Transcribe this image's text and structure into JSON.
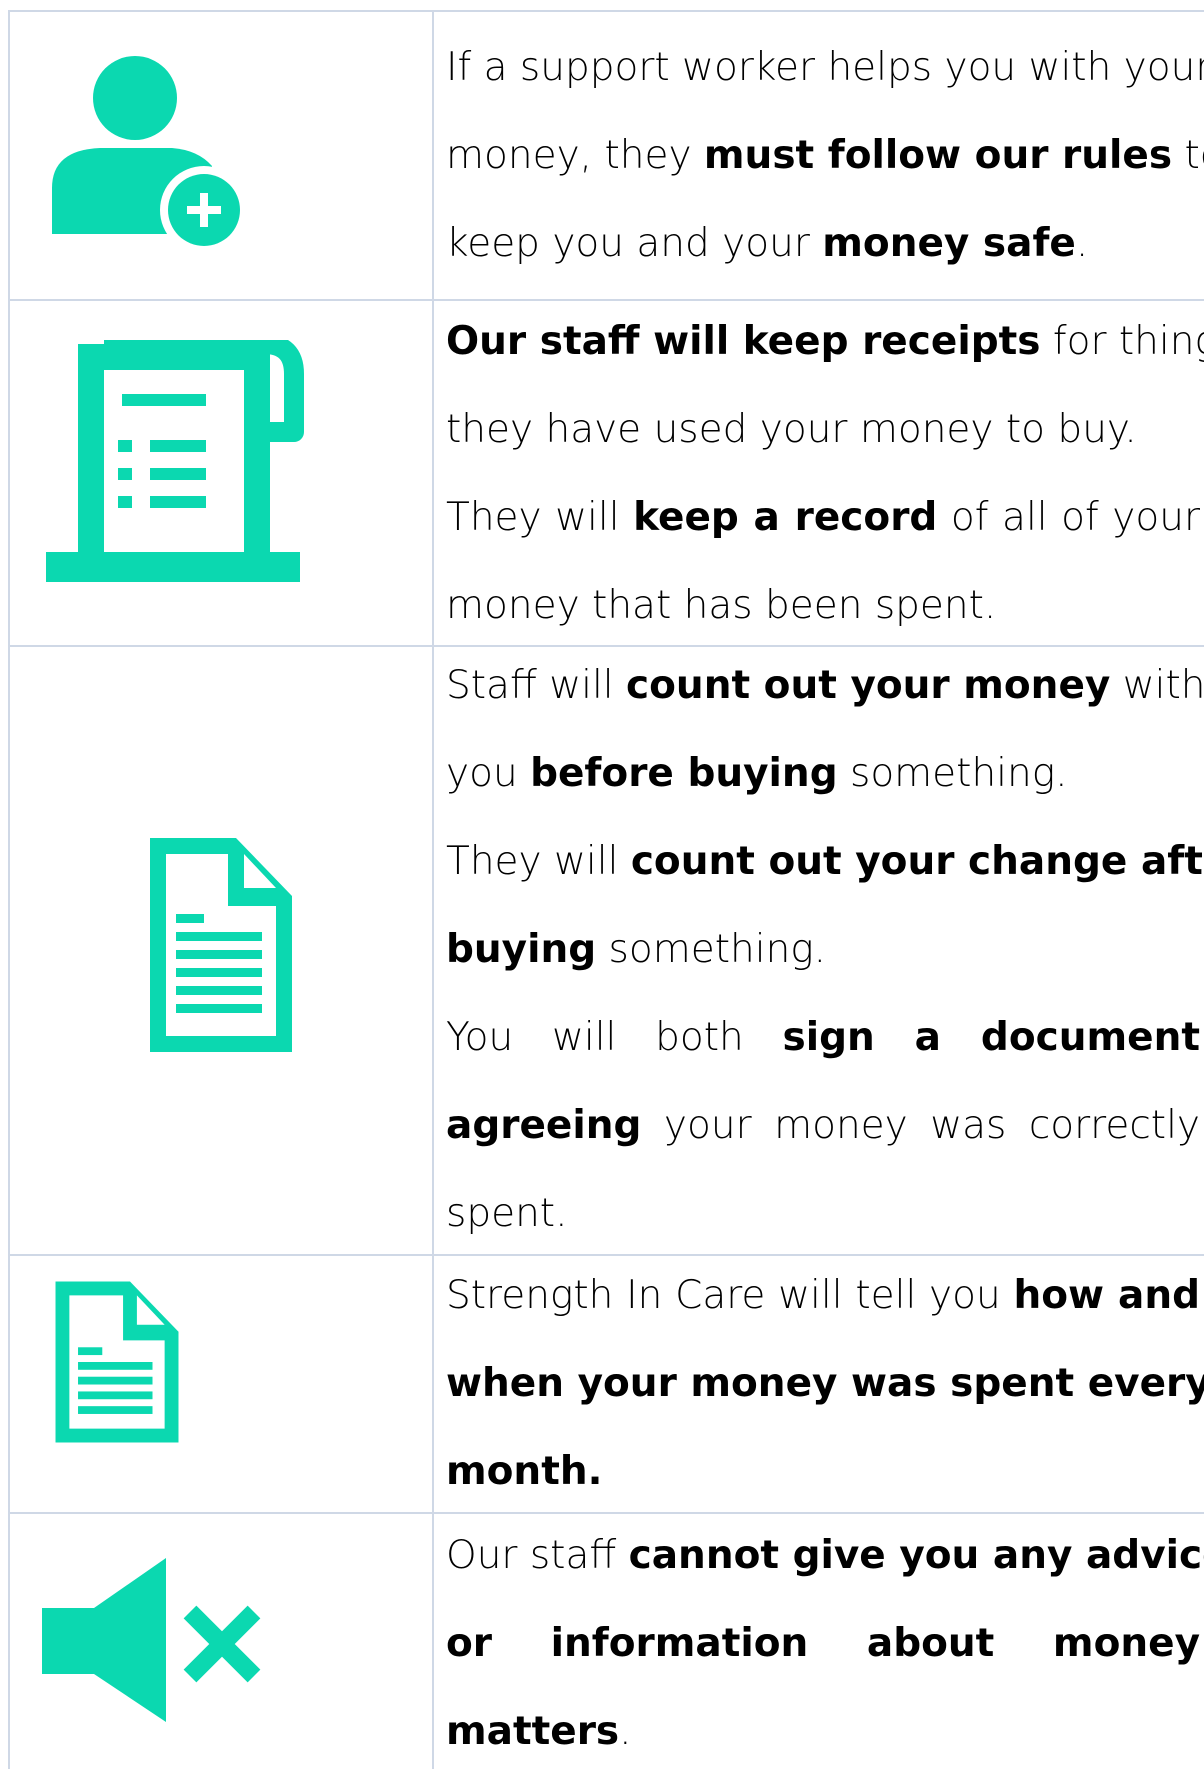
{
  "accent_color": "#0bd8b0",
  "rows": [
    {
      "icon": "add-user-icon",
      "lines": [
        [
          {
            "t": "If a support worker helps you with your",
            "b": false
          }
        ],
        [
          {
            "t": "money, they ",
            "b": false
          },
          {
            "t": "must follow our rules",
            "b": true
          },
          {
            "t": " to",
            "b": false
          }
        ],
        [
          {
            "t": "keep you and your ",
            "b": false
          },
          {
            "t": "money safe",
            "b": true
          },
          {
            "t": ".",
            "b": false
          }
        ]
      ]
    },
    {
      "icon": "receipt-icon",
      "lines": [
        [
          {
            "t": "Our staff will keep receipts",
            "b": true
          },
          {
            "t": " for things",
            "b": false
          }
        ],
        [
          {
            "t": "they have used your money to buy.",
            "b": false
          }
        ],
        [
          {
            "t": "They will ",
            "b": false
          },
          {
            "t": "keep a record",
            "b": true
          },
          {
            "t": " of all of your",
            "b": false
          }
        ],
        [
          {
            "t": "money that has been spent.",
            "b": false
          }
        ]
      ]
    },
    {
      "icon": "document-icon",
      "lines": [
        [
          {
            "t": "Staff will ",
            "b": false
          },
          {
            "t": "count out your money",
            "b": true
          },
          {
            "t": " with",
            "b": false
          }
        ],
        [
          {
            "t": "you ",
            "b": false
          },
          {
            "t": "before buying",
            "b": true
          },
          {
            "t": " something.",
            "b": false
          }
        ],
        [
          {
            "t": "They will ",
            "b": false
          },
          {
            "t": "count out your change after",
            "b": true
          }
        ],
        [
          {
            "t": "buying",
            "b": true
          },
          {
            "t": " something.",
            "b": false
          }
        ],
        [
          {
            "t": "You will both ",
            "b": false
          },
          {
            "t": "sign a document",
            "b": true
          }
        ],
        [
          {
            "t": "agreeing",
            "b": true
          },
          {
            "t": " your money was correctly",
            "b": false
          }
        ],
        [
          {
            "t": "spent.",
            "b": false
          }
        ]
      ]
    },
    {
      "icon": "document-icon",
      "lines": [
        [
          {
            "t": "Strength In Care will tell you ",
            "b": false
          },
          {
            "t": "how and",
            "b": true
          }
        ],
        [
          {
            "t": "when your money was spent every",
            "b": true
          }
        ],
        [
          {
            "t": "month.",
            "b": true
          }
        ]
      ]
    },
    {
      "icon": "mute-speaker-icon",
      "lines": [
        [
          {
            "t": "Our staff ",
            "b": false
          },
          {
            "t": "cannot give you any advice",
            "b": true
          }
        ],
        [
          {
            "t": "or information about money",
            "b": true
          }
        ],
        [
          {
            "t": "matters",
            "b": true
          },
          {
            "t": ".",
            "b": false
          }
        ]
      ]
    }
  ]
}
